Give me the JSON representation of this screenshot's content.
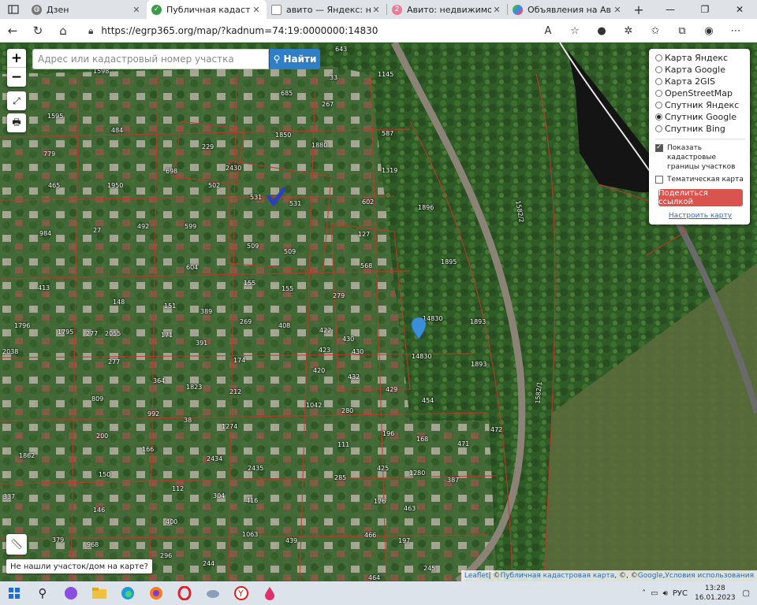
{
  "browser": {
    "tabs": [
      {
        "title": "Дзен",
        "icon": "globe-icon",
        "active": false
      },
      {
        "title": "Публичная кадастровая карт",
        "icon": "check-shield-icon",
        "active": true
      },
      {
        "title": "авито — Яндекс: нашлось",
        "icon": "document-icon",
        "active": false
      },
      {
        "title": "Авито: недвижимость, тр",
        "icon": "avito-icon",
        "active": false
      },
      {
        "title": "Объявления на Авито Ро",
        "icon": "avito-icon",
        "active": false
      }
    ],
    "new_tab_label": "+",
    "url": "https://egrp365.org/map/?kadnum=74:19:0000000:14830"
  },
  "map": {
    "search_placeholder": "Адрес или кадастровый номер участка",
    "search_value": "",
    "find_button": "Найти",
    "zoom_in": "+",
    "zoom_out": "−",
    "layers": [
      {
        "label": "Карта Яндекс",
        "selected": false
      },
      {
        "label": "Карта Google",
        "selected": false
      },
      {
        "label": "Карта 2GIS",
        "selected": false
      },
      {
        "label": "OpenStreetMap",
        "selected": false
      },
      {
        "label": "Спутник Яндекс",
        "selected": false
      },
      {
        "label": "Спутник Google",
        "selected": true
      },
      {
        "label": "Спутник Bing",
        "selected": false
      }
    ],
    "show_boundaries_label": "Показать кадастровые границы участков",
    "show_boundaries_checked": true,
    "thematic_label": "Тематическая карта",
    "thematic_checked": false,
    "share_button": "Поделиться ссылкой",
    "configure_link": "Настроить карту",
    "not_found_label": "Не нашли участок/дом на карте?",
    "attribution": {
      "leaflet": "Leaflet",
      "sep1": " | © ",
      "cadastral": "Публичная кадастровая карта",
      "sep2": ", ©, © ",
      "google": "Google",
      "sep3": ", ",
      "terms": "Условия использования"
    },
    "parcel_labels": [
      {
        "t": "643"
      },
      {
        "t": "1598"
      },
      {
        "t": "33"
      },
      {
        "t": "1145"
      },
      {
        "t": "685"
      },
      {
        "t": "267"
      },
      {
        "t": "1595"
      },
      {
        "t": "484"
      },
      {
        "t": "1850"
      },
      {
        "t": "1880"
      },
      {
        "t": "587"
      },
      {
        "t": "229"
      },
      {
        "t": "779"
      },
      {
        "t": "698"
      },
      {
        "t": "2430"
      },
      {
        "t": "1319"
      },
      {
        "t": "465"
      },
      {
        "t": "1950"
      },
      {
        "t": "502"
      },
      {
        "t": "531"
      },
      {
        "t": "531"
      },
      {
        "t": "602"
      },
      {
        "t": "1896"
      },
      {
        "t": "27"
      },
      {
        "t": "492"
      },
      {
        "t": "599"
      },
      {
        "t": "127"
      },
      {
        "t": "984"
      },
      {
        "t": "509"
      },
      {
        "t": "509"
      },
      {
        "t": "1895"
      },
      {
        "t": "604"
      },
      {
        "t": "568"
      },
      {
        "t": "413"
      },
      {
        "t": "155"
      },
      {
        "t": "155"
      },
      {
        "t": "279"
      },
      {
        "t": "148"
      },
      {
        "t": "151"
      },
      {
        "t": "389"
      },
      {
        "t": "14830"
      },
      {
        "t": "1893"
      },
      {
        "t": "1796"
      },
      {
        "t": "1795"
      },
      {
        "t": "277"
      },
      {
        "t": "2055"
      },
      {
        "t": "269"
      },
      {
        "t": "408"
      },
      {
        "t": "422"
      },
      {
        "t": "171"
      },
      {
        "t": "391"
      },
      {
        "t": "430"
      },
      {
        "t": "423"
      },
      {
        "t": "430"
      },
      {
        "t": "2038"
      },
      {
        "t": "277"
      },
      {
        "t": "174"
      },
      {
        "t": "420"
      },
      {
        "t": "14830"
      },
      {
        "t": "1893"
      },
      {
        "t": "364"
      },
      {
        "t": "1823"
      },
      {
        "t": "432"
      },
      {
        "t": "429"
      },
      {
        "t": "809"
      },
      {
        "t": "212"
      },
      {
        "t": "1042"
      },
      {
        "t": "454"
      },
      {
        "t": "992"
      },
      {
        "t": "38"
      },
      {
        "t": "280"
      },
      {
        "t": "472"
      },
      {
        "t": "200"
      },
      {
        "t": "1274"
      },
      {
        "t": "196"
      },
      {
        "t": "168"
      },
      {
        "t": "471"
      },
      {
        "t": "166"
      },
      {
        "t": "111"
      },
      {
        "t": "1862"
      },
      {
        "t": "2434"
      },
      {
        "t": "2435"
      },
      {
        "t": "425"
      },
      {
        "t": "150"
      },
      {
        "t": "285"
      },
      {
        "t": "1280"
      },
      {
        "t": "387"
      },
      {
        "t": "337"
      },
      {
        "t": "112"
      },
      {
        "t": "304"
      },
      {
        "t": "416"
      },
      {
        "t": "126"
      },
      {
        "t": "463"
      },
      {
        "t": "146"
      },
      {
        "t": "400"
      },
      {
        "t": "1063"
      },
      {
        "t": "439"
      },
      {
        "t": "466"
      },
      {
        "t": "197"
      },
      {
        "t": "379"
      },
      {
        "t": "968"
      },
      {
        "t": "296"
      },
      {
        "t": "244"
      },
      {
        "t": "245"
      },
      {
        "t": "464"
      },
      {
        "t": "1582/2"
      },
      {
        "t": "1582/1"
      }
    ]
  },
  "taskbar": {
    "language": "РУС",
    "time": "13:28",
    "date": "16.01.2023"
  }
}
